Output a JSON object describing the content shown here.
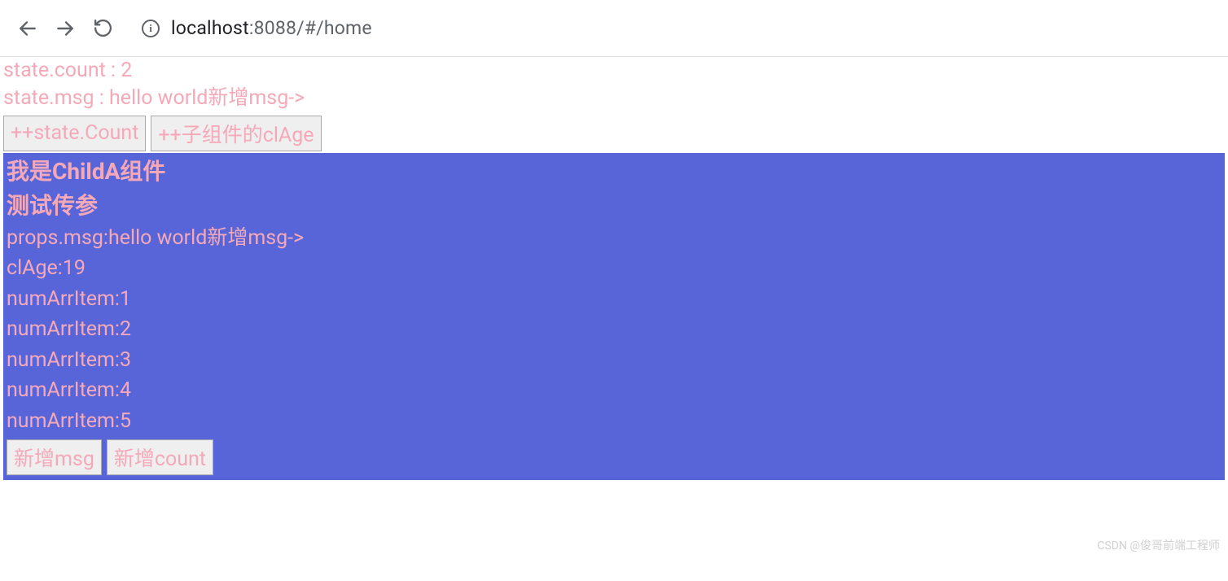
{
  "browser": {
    "url_host": "localhost",
    "url_rest": ":8088/#/home"
  },
  "parent": {
    "state_count_line": "state.count : 2",
    "state_msg_line": "state.msg : hello world新增msg->",
    "btn_state_count": "++state.Count",
    "btn_child_clage": "++子组件的clAge"
  },
  "child": {
    "title": "我是ChildA组件",
    "subtitle": "测试传参",
    "props_msg": "props.msg:hello world新增msg->",
    "clage": "clAge:19",
    "items": [
      "numArrItem:1",
      "numArrItem:2",
      "numArrItem:3",
      "numArrItem:4",
      "numArrItem:5"
    ],
    "btn_add_msg": "新增msg",
    "btn_add_count": "新增count"
  },
  "watermark": "CSDN @俊哥前端工程师"
}
